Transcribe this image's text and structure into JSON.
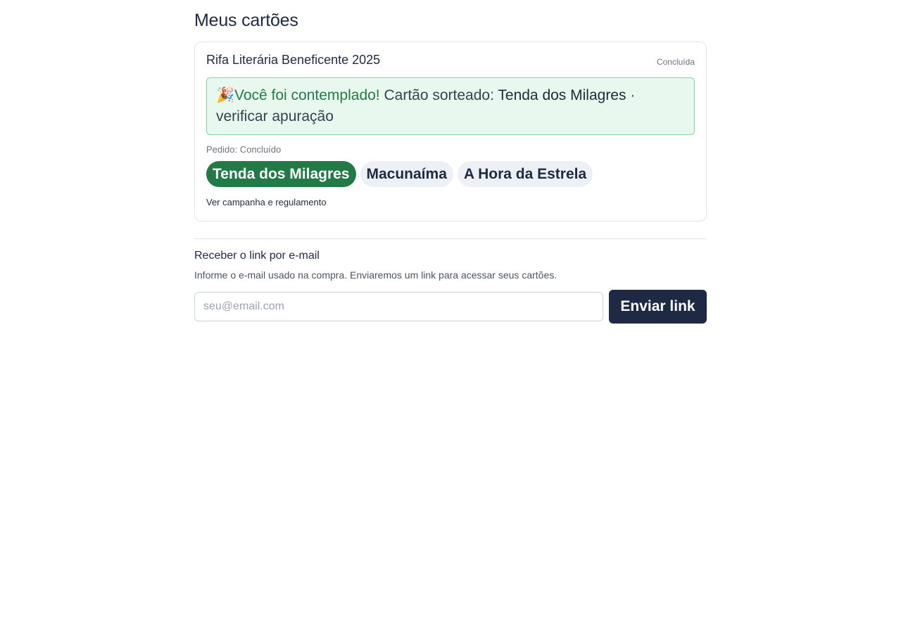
{
  "page": {
    "title": "Meus cartões"
  },
  "raffle": {
    "title": "Rifa Literária Beneficente 2025",
    "status": "Concluída",
    "winner_icon": "🎉",
    "winner_icon_name": "party-popper-icon",
    "winner_message": "Você foi contemplado!",
    "drawn_label": "Cartão sorteado:",
    "drawn_card": "Tenda dos Milagres",
    "separator": "·",
    "verify_link": "verificar apuração",
    "order_status": "Pedido: Concluído",
    "cards": [
      {
        "name": "Tenda dos Milagres",
        "selected": true
      },
      {
        "name": "Macunaíma",
        "selected": false
      },
      {
        "name": "A Hora da Estrela",
        "selected": false
      }
    ],
    "campaign_link": "Ver campanha e regulamento"
  },
  "email_section": {
    "title": "Receber o link por e-mail",
    "description": "Informe o e-mail usado na compra. Enviaremos um link para acessar seus cartões.",
    "input_placeholder": "seu@email.com",
    "input_value": "",
    "button_label": "Enviar link"
  },
  "colors": {
    "primary": "#1e2a44",
    "success": "#227a46",
    "success_bg": "#e9f8ee",
    "success_border": "#86d39f",
    "pill_bg": "#edf0f5",
    "border": "#e5e7eb"
  }
}
